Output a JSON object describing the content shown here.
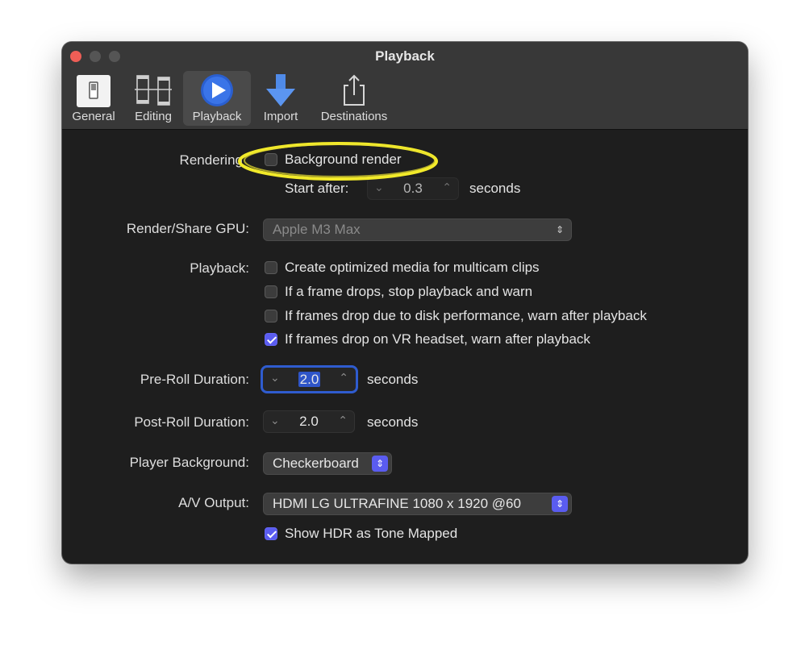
{
  "window": {
    "title": "Playback"
  },
  "toolbar": {
    "tabs": [
      {
        "label": "General",
        "icon": "general-switch-icon"
      },
      {
        "label": "Editing",
        "icon": "film-editing-icon"
      },
      {
        "label": "Playback",
        "icon": "play-circle-icon"
      },
      {
        "label": "Import",
        "icon": "import-arrow-icon"
      },
      {
        "label": "Destinations",
        "icon": "share-icon"
      }
    ],
    "active": "Playback"
  },
  "rendering": {
    "label": "Rendering",
    "background_render": {
      "label": "Background render",
      "checked": false
    },
    "start_after": {
      "label": "Start after:",
      "value": "0.3",
      "unit": "seconds"
    }
  },
  "gpu": {
    "label": "Render/Share GPU:",
    "value": "Apple M3 Max"
  },
  "playback": {
    "label": "Playback:",
    "options": [
      {
        "label": "Create optimized media for multicam clips",
        "checked": false
      },
      {
        "label": "If a frame drops, stop playback and warn",
        "checked": false
      },
      {
        "label": "If frames drop due to disk performance, warn after playback",
        "checked": false
      },
      {
        "label": "If frames drop on VR headset, warn after playback",
        "checked": true
      }
    ]
  },
  "preroll": {
    "label": "Pre-Roll Duration:",
    "value": "2.0",
    "unit": "seconds"
  },
  "postroll": {
    "label": "Post-Roll Duration:",
    "value": "2.0",
    "unit": "seconds"
  },
  "player_bg": {
    "label": "Player Background:",
    "value": "Checkerboard"
  },
  "av_output": {
    "label": "A/V Output:",
    "value": "HDMI LG ULTRAFINE 1080 x 1920 @60",
    "hdr": {
      "label": "Show HDR as Tone Mapped",
      "checked": true
    }
  },
  "colors": {
    "accent": "#5a5cf0",
    "highlight_annotation": "#f2ea2a",
    "window_bg": "#1e1e1e"
  }
}
